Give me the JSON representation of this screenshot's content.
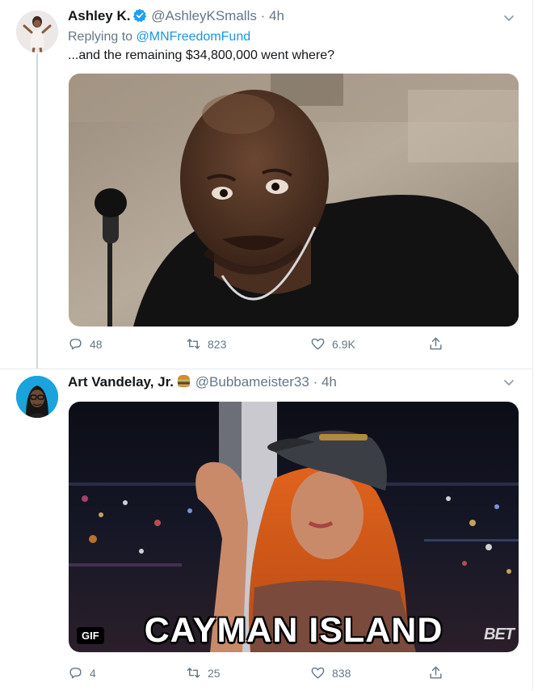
{
  "tweets": [
    {
      "name": "Ashley K.",
      "handle": "@AshleyKSmalls",
      "separator": "·",
      "time": "4h",
      "reply_prefix": "Replying to",
      "reply_to": "@MNFreedomFund",
      "text": "...and the remaining $34,800,000 went where?",
      "stats": {
        "replies": "48",
        "retweets": "823",
        "likes": "6.9K"
      },
      "verified": true
    },
    {
      "name": "Art Vandelay, Jr.",
      "name_emoji": "burger-icon",
      "handle": "@Bubbameister33",
      "separator": "·",
      "time": "4h",
      "media": {
        "badge": "GIF",
        "caption": "CAYMAN ISLAND",
        "watermark": "BET"
      },
      "stats": {
        "replies": "4",
        "retweets": "25",
        "likes": "838"
      }
    }
  ],
  "colors": {
    "link": "#1b95e0",
    "muted": "#657786",
    "text": "#14171a",
    "verified": "#1da1f2"
  }
}
